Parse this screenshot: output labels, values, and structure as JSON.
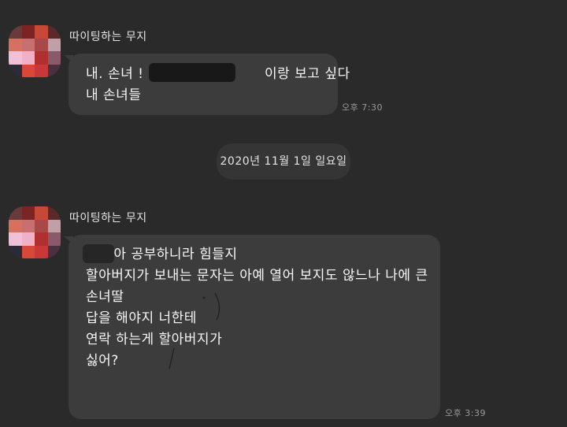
{
  "messages": [
    {
      "sender": "따이팅하는 무지",
      "lines": [
        "내. 손녀 !                          이랑 보고 싶다",
        "내 손녀들"
      ],
      "time": "오후 7:30"
    },
    {
      "sender": "따이팅하는 무지",
      "lines": [
        "      아 공부하니라 힘들지",
        "할아버지가 보내는 문자는 아예 열어 보지도 않느나 나에 큰",
        "손녀딸",
        "답을 해야지 너한테",
        "연락 하는게 할아버지가",
        "싫어?"
      ],
      "time": "오후 3:39"
    }
  ],
  "date_divider": "2020년 11월 1일 일요일",
  "colors": {
    "background": "#2a2a2a",
    "bubble": "#3c3c3c",
    "pill": "#353535",
    "text": "#f7f7f7",
    "time": "#9a9a9a"
  },
  "avatar_mosaic": [
    "#6a3a3a",
    "#7a2424",
    "#c84838",
    "#5a2a2a",
    "#d87060",
    "#c87070",
    "#a84848",
    "#bfa0a8",
    "#f0c0d8",
    "#f0b0c8",
    "#b03030",
    "#8a5a6a",
    "#2a2a3a",
    "#d84838",
    "#c83838",
    "#4a3040"
  ]
}
